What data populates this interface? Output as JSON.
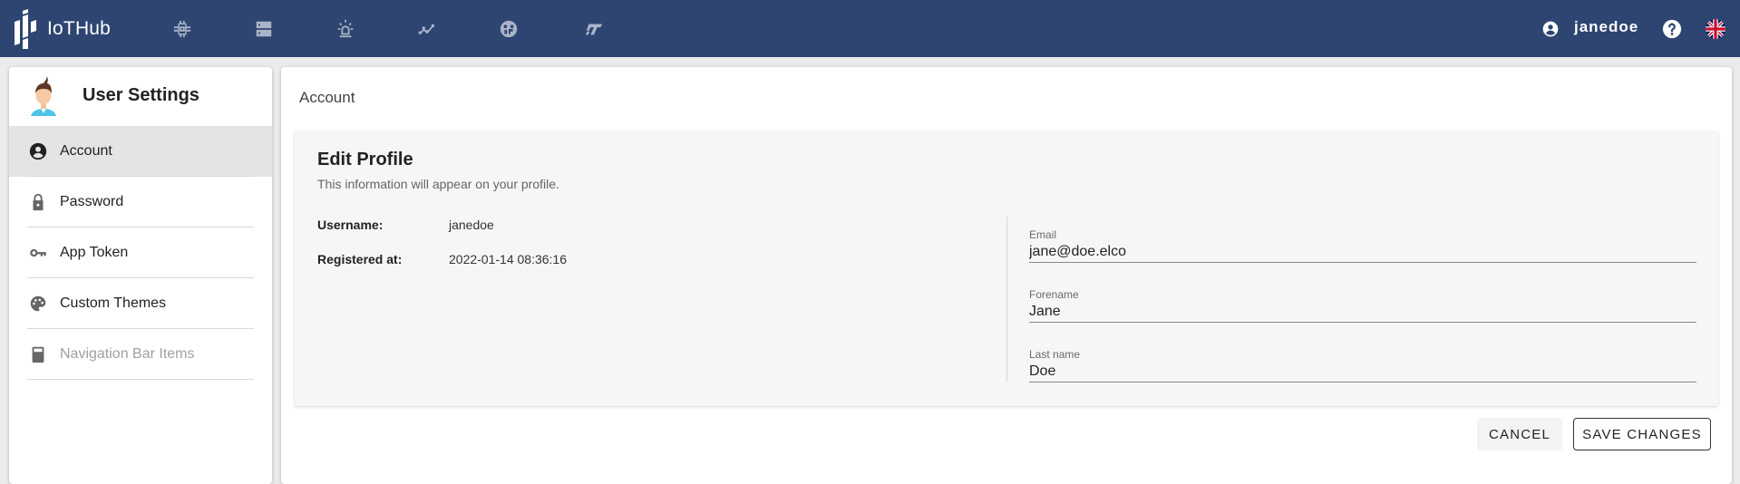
{
  "header": {
    "app_name": "IoTHub",
    "nav_icons": [
      {
        "name": "device-chip-icon",
        "label": "Devices"
      },
      {
        "name": "storage-icon",
        "label": "Storage"
      },
      {
        "name": "alarm-icon",
        "label": "Alarms"
      },
      {
        "name": "timeline-icon",
        "label": "Analytics"
      },
      {
        "name": "dashboard-icon",
        "label": "Dashboard"
      },
      {
        "name": "flow-icon",
        "label": "Flow"
      }
    ],
    "username": "janedoe",
    "help_icon": "help-icon",
    "language_icon": "uk-flag-icon"
  },
  "sidebar": {
    "title": "User Settings",
    "items": [
      {
        "label": "Account",
        "icon": "account-circle-icon",
        "active": true,
        "disabled": false
      },
      {
        "label": "Password",
        "icon": "lock-icon",
        "active": false,
        "disabled": false
      },
      {
        "label": "App Token",
        "icon": "key-icon",
        "active": false,
        "disabled": false
      },
      {
        "label": "Custom Themes",
        "icon": "palette-icon",
        "active": false,
        "disabled": false
      },
      {
        "label": "Navigation Bar Items",
        "icon": "calculator-icon",
        "active": false,
        "disabled": true
      }
    ]
  },
  "main": {
    "title": "Account",
    "card": {
      "title": "Edit Profile",
      "subtitle": "This information will appear on your profile.",
      "info": [
        {
          "label": "Username:",
          "value": "janedoe"
        },
        {
          "label": "Registered at:",
          "value": "2022-01-14 08:36:16"
        }
      ],
      "fields": [
        {
          "label": "Email",
          "value": "jane@doe.elco"
        },
        {
          "label": "Forename",
          "value": "Jane"
        },
        {
          "label": "Last name",
          "value": "Doe"
        }
      ]
    },
    "actions": {
      "cancel_label": "CANCEL",
      "save_label": "SAVE CHANGES"
    }
  },
  "colors": {
    "topbar": "#2e4571",
    "nav_icon": "#aab4c8",
    "active_item_bg": "#e4e4e4",
    "card_bg": "#f6f6f6"
  }
}
